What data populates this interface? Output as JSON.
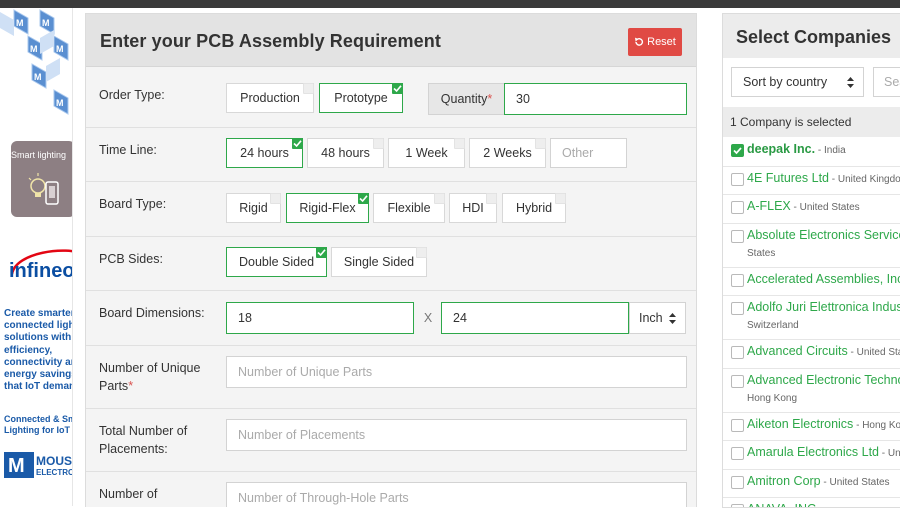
{
  "left_ad": {
    "smart_lighting": "Smart lighting",
    "brand": "infineon",
    "copy_lines": [
      "Create smarter",
      "connected lighting",
      "solutions with",
      "efficiency,",
      "connectivity and",
      "energy savings",
      "that IoT demands"
    ],
    "copy2_lines": [
      "Connected & Smart",
      "Lighting for IoT"
    ],
    "mouser_line1": "MOUSER",
    "mouser_line2": "ELECTRONICS",
    "brand_color": "#1a5aa8"
  },
  "form": {
    "title": "Enter your PCB Assembly Requirement",
    "reset_label": "Reset",
    "order_type": {
      "label": "Order Type:",
      "options": [
        {
          "label": "Production",
          "selected": false
        },
        {
          "label": "Prototype",
          "selected": true
        }
      ],
      "quantity_label": "Quantity",
      "quantity_value": "30"
    },
    "time_line": {
      "label": "Time Line:",
      "options": [
        {
          "label": "24 hours",
          "selected": true
        },
        {
          "label": "48 hours",
          "selected": false
        },
        {
          "label": "1 Week",
          "selected": false
        },
        {
          "label": "2 Weeks",
          "selected": false
        }
      ],
      "other_placeholder": "Other"
    },
    "board_type": {
      "label": "Board Type:",
      "options": [
        {
          "label": "Rigid",
          "selected": false
        },
        {
          "label": "Rigid-Flex",
          "selected": true
        },
        {
          "label": "Flexible",
          "selected": false
        },
        {
          "label": "HDI",
          "selected": false
        },
        {
          "label": "Hybrid",
          "selected": false
        }
      ]
    },
    "pcb_sides": {
      "label": "PCB Sides:",
      "options": [
        {
          "label": "Double Sided",
          "selected": true
        },
        {
          "label": "Single Sided",
          "selected": false
        }
      ]
    },
    "board_dimensions": {
      "label": "Board Dimensions:",
      "width": "18",
      "separator": "X",
      "height": "24",
      "unit": "Inch"
    },
    "unique_parts": {
      "label_line1": "Number of Unique",
      "label_line2": "Parts",
      "placeholder": "Number of Unique Parts"
    },
    "placements": {
      "label_line1": "Total Number of",
      "label_line2": "Placements:",
      "placeholder": "Number of Placements"
    },
    "through_hole": {
      "label_line1": "Number of",
      "placeholder": "Number of Through-Hole Parts"
    },
    "accent_color": "#2ea84a",
    "reset_color": "#e04a44"
  },
  "companies": {
    "title": "Select Companies",
    "sort_label": "Sort by country",
    "search_placeholder": "Sea",
    "selected_count": "1 Company is selected",
    "items": [
      {
        "name": "deepak Inc.",
        "country": " - India",
        "checked": true
      },
      {
        "name": "4E Futures Ltd",
        "country": " - United Kingdo",
        "checked": false
      },
      {
        "name": "A-FLEX",
        "country": " - United States",
        "checked": false
      },
      {
        "name": "Absolute Electronics Service",
        "sub": "States",
        "checked": false
      },
      {
        "name": "Accelerated Assemblies, Inc",
        "checked": false
      },
      {
        "name": "Adolfo Juri Elettronica Indus",
        "sub": "Switzerland",
        "checked": false
      },
      {
        "name": "Advanced Circuits",
        "country": " - United Sta",
        "checked": false
      },
      {
        "name": "Advanced Electronic Techno",
        "sub": "Hong Kong",
        "checked": false
      },
      {
        "name": "Aiketon Electronics",
        "country": " - Hong Ko",
        "checked": false
      },
      {
        "name": "Amarula Electronics Ltd",
        "country": " - Uni",
        "checked": false
      },
      {
        "name": "Amitron Corp",
        "country": " - United States",
        "checked": false
      },
      {
        "name": "ANAVA, INC",
        "country": "",
        "checked": false
      }
    ]
  }
}
